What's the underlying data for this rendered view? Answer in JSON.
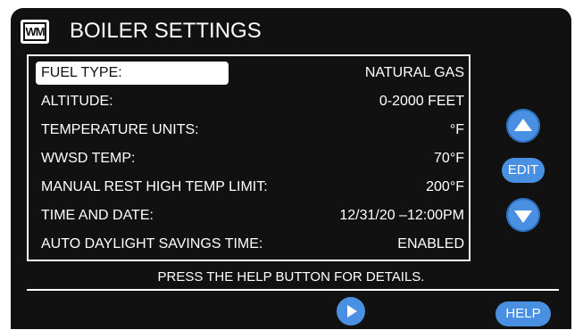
{
  "header": {
    "title": "BOILER SETTINGS",
    "logo_text": "WM"
  },
  "settings": [
    {
      "label": "FUEL TYPE:",
      "value": "NATURAL GAS"
    },
    {
      "label": "ALTITUDE:",
      "value": "0-2000 FEET"
    },
    {
      "label": "TEMPERATURE UNITS:",
      "value": "°F"
    },
    {
      "label": "WWSD TEMP:",
      "value": "70°F"
    },
    {
      "label": "MANUAL REST HIGH TEMP LIMIT:",
      "value": "200°F"
    },
    {
      "label": "TIME AND DATE:",
      "value": "12/31/20 –12:00PM"
    },
    {
      "label": "AUTO DAYLIGHT SAVINGS TIME:",
      "value": "ENABLED"
    }
  ],
  "controls": {
    "edit_label": "EDIT",
    "help_label": "HELP",
    "up_icon": "up-arrow-icon",
    "down_icon": "down-arrow-icon",
    "next_icon": "play-icon"
  },
  "footer": {
    "hint": "PRESS THE HELP BUTTON FOR DETAILS."
  },
  "colors": {
    "accent": "#4a90e2",
    "screen_bg": "#111111",
    "text": "#ffffff"
  }
}
